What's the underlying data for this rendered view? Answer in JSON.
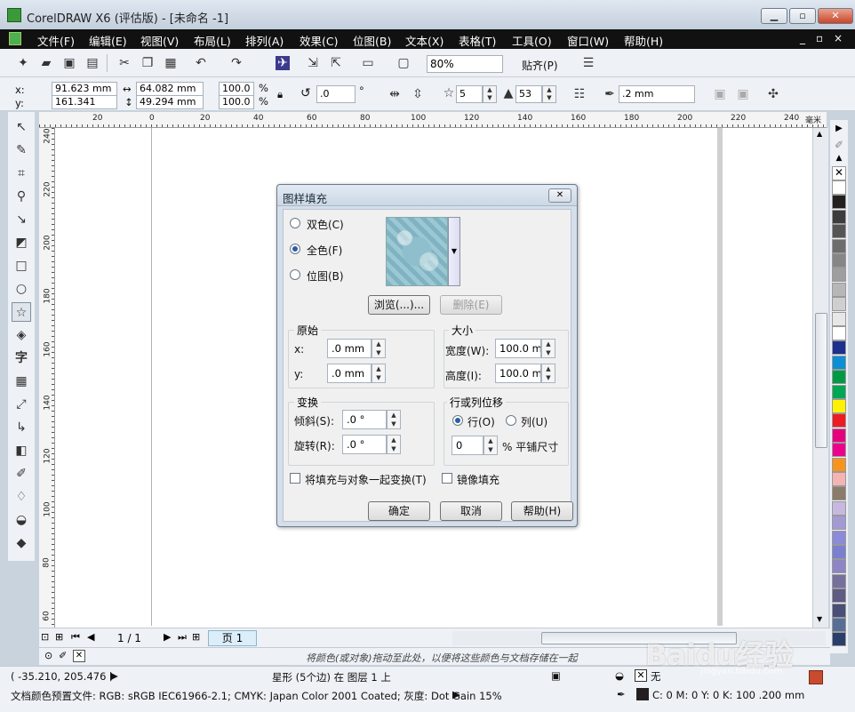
{
  "window": {
    "title": "CorelDRAW X6 (评估版) - [未命名 -1]",
    "minimize": "▁",
    "restore": "▫",
    "close": "✕"
  },
  "menu": [
    "文件(F)",
    "编辑(E)",
    "视图(V)",
    "布局(L)",
    "排列(A)",
    "效果(C)",
    "位图(B)",
    "文本(X)",
    "表格(T)",
    "工具(O)",
    "窗口(W)",
    "帮助(H)"
  ],
  "menu_controls": [
    "_",
    "▫",
    "×"
  ],
  "toolbar": {
    "zoom": "80%",
    "snap": "贴齐(P)"
  },
  "property_bar": {
    "x_label": "x:",
    "x_value": "91.623 mm",
    "y_label": "y:",
    "y_value": "161.341 mm",
    "width_value": "64.082 mm",
    "height_value": "49.294 mm",
    "scale_w": "100.0",
    "scale_h": "100.0",
    "percent": "%",
    "rotation": ".0",
    "degree": "°",
    "points": "5",
    "sharpness": "53",
    "outline_width": ".2 mm"
  },
  "ruler": {
    "h_ticks": [
      "20",
      "0",
      "20",
      "40",
      "60",
      "80",
      "100",
      "120",
      "140",
      "160",
      "180",
      "200",
      "220",
      "240"
    ],
    "unit": "毫米",
    "v_ticks": [
      "240",
      "220",
      "200",
      "180",
      "160",
      "140",
      "120",
      "100",
      "80",
      "60"
    ],
    "v_unit": "毫米"
  },
  "page_nav": {
    "counter": "1 / 1",
    "tab": "页 1"
  },
  "color_row_hint": "将颜色(或对象)拖动至此处，以便将这些颜色与文档存储在一起",
  "status": {
    "coords": "( -35.210, 205.476 )",
    "object_info": "星形 (5个边) 在 图层 1 上",
    "profiles": "文档颜色预置文件: RGB: sRGB IEC61966-2.1; CMYK: Japan Color 2001 Coated; 灰度: Dot Gain 15%",
    "fill_label": "无",
    "outline_info": "C: 0 M: 0 Y: 0 K: 100  .200 mm"
  },
  "palette_colors": [
    "#ffffff",
    "#231f20",
    "#3d3d3d",
    "#555555",
    "#6d6d6d",
    "#868686",
    "#9e9e9e",
    "#b7b7b7",
    "#cfcfcf",
    "#e7e7e7",
    "#ffffff",
    "#1d2f8f",
    "#0a8fd4",
    "#009a44",
    "#00a651",
    "#fff200",
    "#ed1c24",
    "#e6007e",
    "#ec008c",
    "#f7941d",
    "#f4b4b4",
    "#8c7b6b",
    "#c7b8e0",
    "#a49ad3",
    "#8b8bd8",
    "#7a7fcf",
    "#8e85c5",
    "#75719c",
    "#5e5b85",
    "#4a4f78",
    "#596e96",
    "#2a3e6b"
  ],
  "dialog": {
    "title": "图样填充",
    "close": "✕",
    "radio_two_color": "双色(C)",
    "radio_full_color": "全色(F)",
    "radio_bitmap": "位图(B)",
    "browse": "浏览(...)...",
    "delete": "删除(E)",
    "origin": {
      "title": "原始",
      "x_label": "x:",
      "x_value": ".0 mm",
      "y_label": "y:",
      "y_value": ".0 mm"
    },
    "size": {
      "title": "大小",
      "width_label": "宽度(W):",
      "width_value": "100.0 mm",
      "height_label": "高度(I):",
      "height_value": "100.0 mm"
    },
    "transform": {
      "title": "变换",
      "skew_label": "倾斜(S):",
      "skew_value": ".0 °",
      "rotate_label": "旋转(R):",
      "rotate_value": ".0 °"
    },
    "offset": {
      "title": "行或列位移",
      "row": "行(O)",
      "column": "列(U)",
      "value": "0",
      "unit": "% 平铺尺寸"
    },
    "transform_with_object": "将填充与对象一起变换(T)",
    "mirror_fill": "镜像填充",
    "ok": "确定",
    "cancel": "取消",
    "help": "帮助(H)"
  },
  "watermark": "Baidu经验",
  "watermark_url": "jingyan.baidu.com"
}
